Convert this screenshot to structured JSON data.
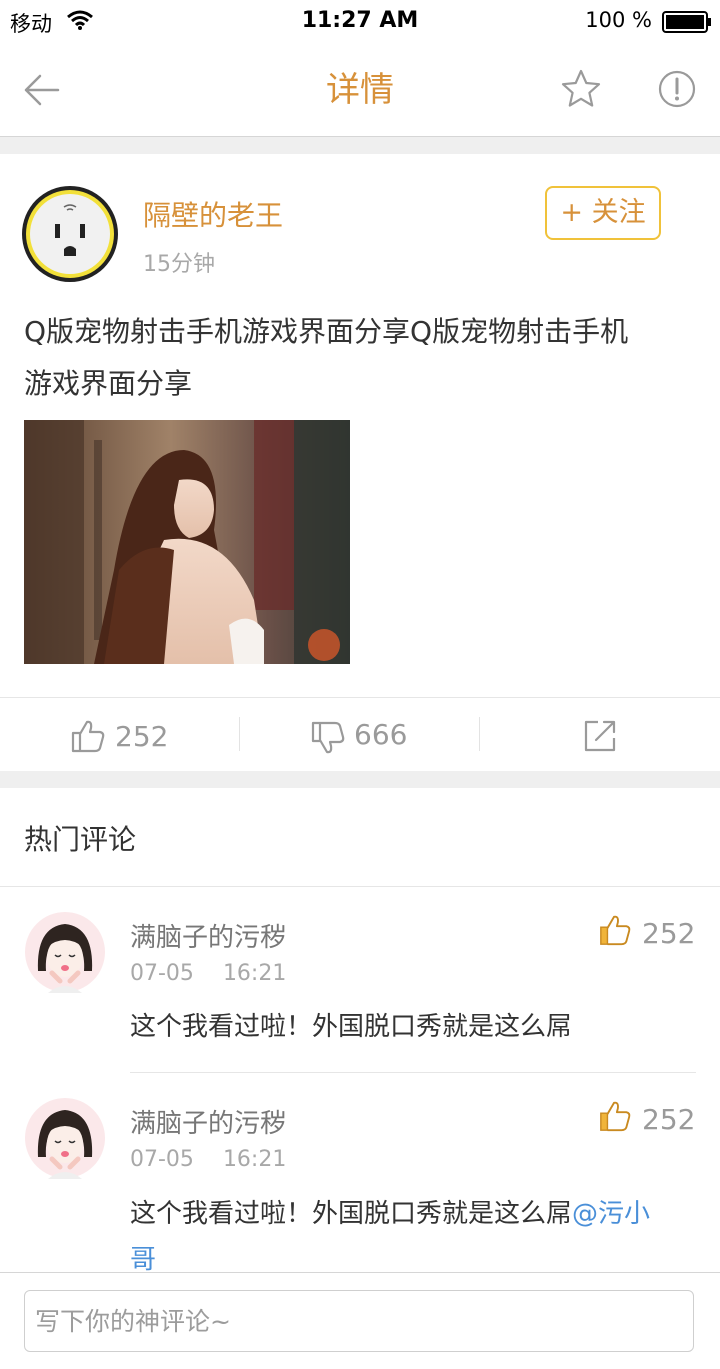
{
  "status_bar": {
    "carrier": "移动",
    "time": "11:27 AM",
    "battery": "100 %"
  },
  "nav": {
    "title": "详情"
  },
  "post": {
    "username": "隔壁的老王",
    "time": "15分钟",
    "follow_label": "+ 关注",
    "text_line1": "Q版宠物射击手机游戏界面分享Q版宠物射击手机",
    "text_line2": "游戏界面分享",
    "likes": "252",
    "dislikes": "666"
  },
  "hot_comments": {
    "title": "热门评论",
    "items": [
      {
        "name": "满脑子的污秽",
        "date": "07-05",
        "time": "16:21",
        "likes": "252",
        "text": "这个我看过啦！外国脱口秀就是这么屌"
      },
      {
        "name": "满脑子的污秽",
        "date": "07-05",
        "time": "16:21",
        "likes": "252",
        "text_line1": "这个我看过啦！外国脱口秀就是这么屌",
        "mention_a": "@污小",
        "mention_b": "哥"
      }
    ]
  },
  "comment_input": {
    "placeholder": "写下你的神评论~"
  },
  "colors": {
    "accent": "#d7913a",
    "follow_border": "#f0c23a",
    "mention": "#4a8fd8",
    "like_icon": "#f0b43a"
  },
  "icons": [
    "wifi-icon",
    "battery-icon",
    "back-arrow-icon",
    "star-icon",
    "report-icon",
    "thumbs-up-icon",
    "thumbs-down-icon",
    "share-icon"
  ]
}
